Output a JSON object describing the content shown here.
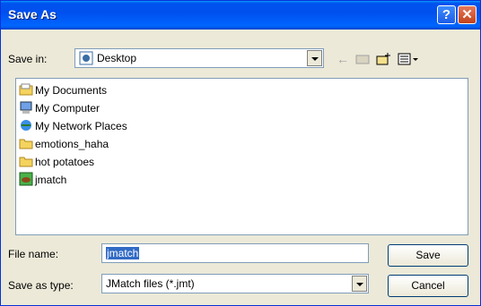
{
  "window": {
    "title": "Save As"
  },
  "save_in": {
    "label": "Save in:",
    "value": "Desktop"
  },
  "toolbar": {
    "back_icon": "back-arrow-icon",
    "up_icon": "up-folder-icon",
    "new_folder_icon": "new-folder-icon",
    "view_icon": "view-menu-icon"
  },
  "files": [
    {
      "name": "My Documents",
      "icon": "my-documents-icon"
    },
    {
      "name": "My Computer",
      "icon": "my-computer-icon"
    },
    {
      "name": "My Network Places",
      "icon": "network-places-icon"
    },
    {
      "name": "emotions_haha",
      "icon": "folder-icon"
    },
    {
      "name": "hot potatoes",
      "icon": "folder-icon"
    },
    {
      "name": "jmatch",
      "icon": "jmatch-file-icon"
    }
  ],
  "file_name": {
    "label": "File name:",
    "value": "jmatch"
  },
  "save_as_type": {
    "label": "Save as type:",
    "value": "JMatch files (*.jmt)"
  },
  "buttons": {
    "save": "Save",
    "cancel": "Cancel"
  }
}
